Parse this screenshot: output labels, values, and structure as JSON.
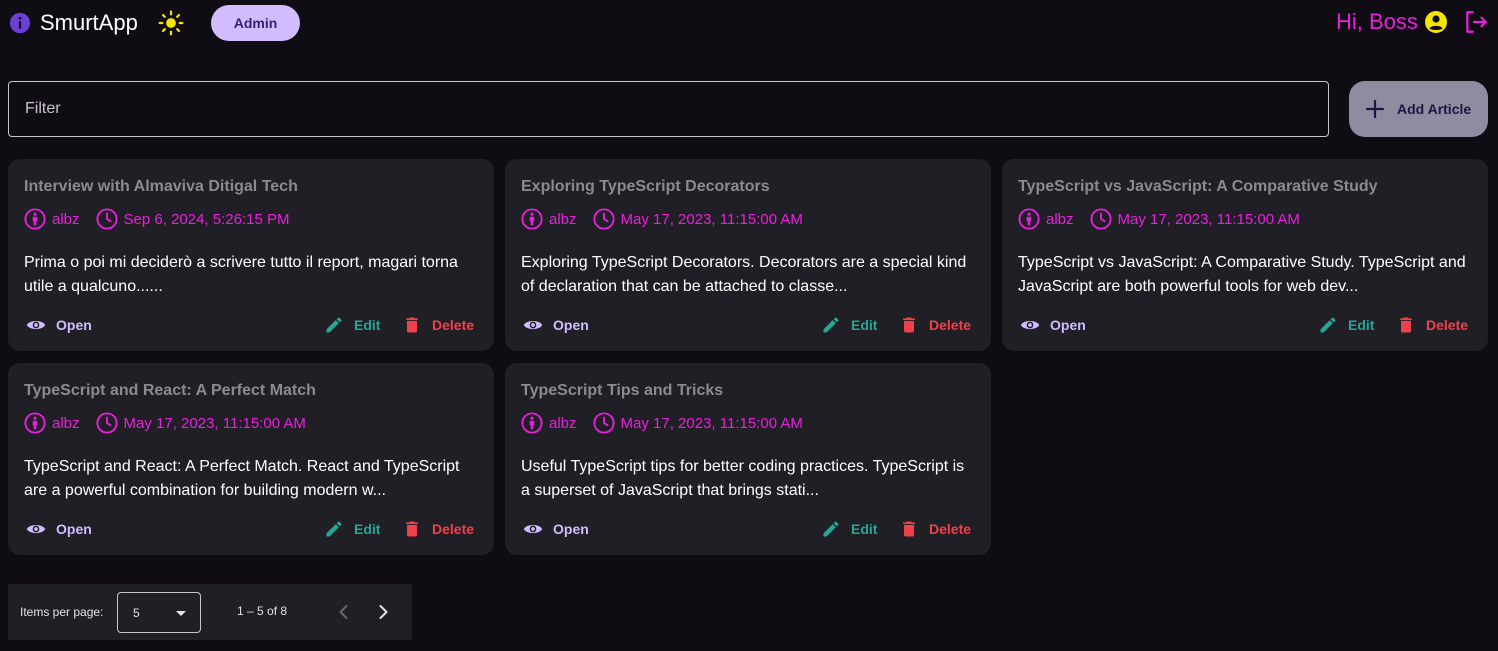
{
  "app": {
    "title": "SmurtApp",
    "role_label": "Admin",
    "greeting": "Hi, Boss"
  },
  "filter": {
    "placeholder": "Filter",
    "value": ""
  },
  "add_button": {
    "label": "Add Article",
    "icon": "plus-icon"
  },
  "colors": {
    "accent_primary": "#d0bcff",
    "accent_magenta": "#e91fdd",
    "edit": "#26a699",
    "delete": "#f2404a",
    "background": "#0f0d13",
    "card": "#211f26"
  },
  "actions": {
    "open": "Open",
    "edit": "Edit",
    "delete": "Delete"
  },
  "articles": [
    {
      "title": "Interview with Almaviva Ditigal Tech",
      "author": "albz",
      "date": "Sep 6, 2024, 5:26:15 PM",
      "excerpt": "Prima o poi mi deciderò a scrivere tutto il report, magari torna utile a qualcuno......"
    },
    {
      "title": "Exploring TypeScript Decorators",
      "author": "albz",
      "date": "May 17, 2023, 11:15:00 AM",
      "excerpt": "Exploring TypeScript Decorators. Decorators are a special kind of declaration that can be attached to classe..."
    },
    {
      "title": "TypeScript vs JavaScript: A Comparative Study",
      "author": "albz",
      "date": "May 17, 2023, 11:15:00 AM",
      "excerpt": "TypeScript vs JavaScript: A Comparative Study. TypeScript and JavaScript are both powerful tools for web dev..."
    },
    {
      "title": "TypeScript and React: A Perfect Match",
      "author": "albz",
      "date": "May 17, 2023, 11:15:00 AM",
      "excerpt": "TypeScript and React: A Perfect Match. React and TypeScript are a powerful combination for building modern w..."
    },
    {
      "title": "TypeScript Tips and Tricks",
      "author": "albz",
      "date": "May 17, 2023, 11:15:00 AM",
      "excerpt": "Useful TypeScript tips for better coding practices. TypeScript is a superset of JavaScript that brings stati..."
    }
  ],
  "paginator": {
    "items_per_page_label": "Items per page:",
    "items_per_page": "5",
    "range_label": "1 – 5 of 8"
  }
}
